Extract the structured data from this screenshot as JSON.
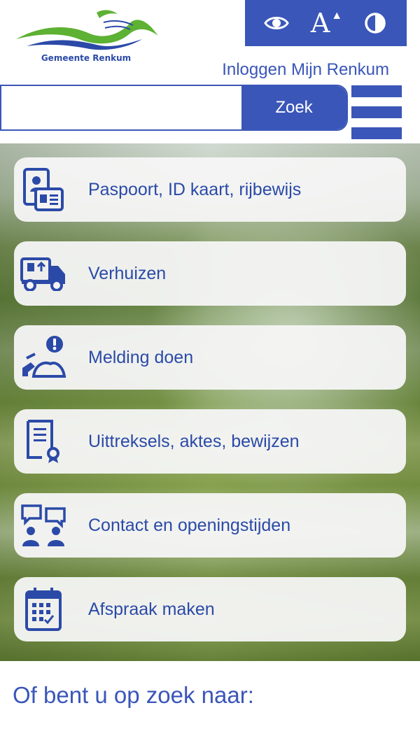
{
  "header": {
    "logo_text": "Gemeente Renkum",
    "login_link": "Inloggen Mijn Renkum"
  },
  "accessibility": {
    "buttons": [
      {
        "icon": "eye-icon"
      },
      {
        "icon": "text-size-icon",
        "glyph": "A"
      },
      {
        "icon": "contrast-icon"
      }
    ]
  },
  "search": {
    "value": "",
    "placeholder": "",
    "button_label": "Zoek"
  },
  "tiles": [
    {
      "label": "Paspoort, ID kaart, rijbewijs",
      "icon": "passport-id-icon"
    },
    {
      "label": "Verhuizen",
      "icon": "moving-truck-icon"
    },
    {
      "label": "Melding doen",
      "icon": "report-issue-icon"
    },
    {
      "label": "Uittreksels, aktes, bewijzen",
      "icon": "certificate-icon"
    },
    {
      "label": "Contact en openingstijden",
      "icon": "contact-chat-icon"
    },
    {
      "label": "Afspraak maken",
      "icon": "calendar-icon"
    }
  ],
  "section": {
    "title": "Of bent u op zoek naar:"
  },
  "colors": {
    "brand_blue": "#3a56b8",
    "logo_green": "#5db133"
  }
}
